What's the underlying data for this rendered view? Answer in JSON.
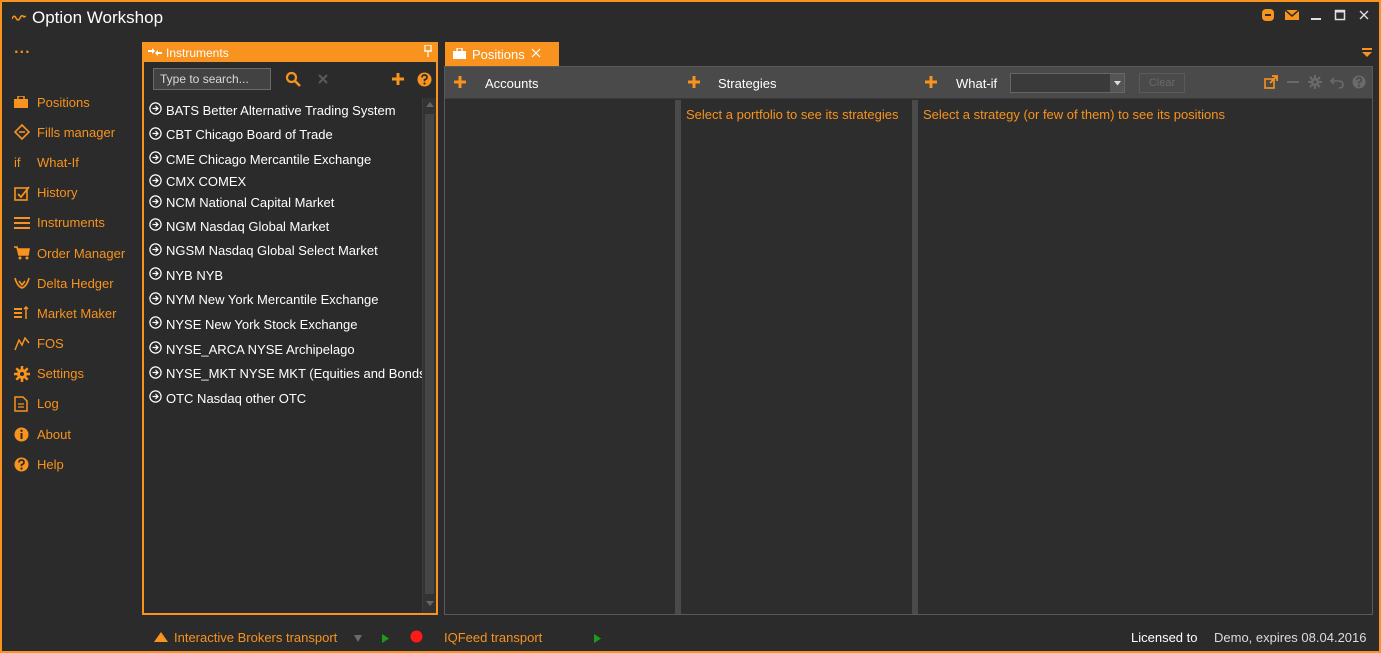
{
  "app": {
    "title": "Option Workshop",
    "accent": "#f7931e"
  },
  "nav": {
    "more": "...",
    "items": [
      {
        "label": "Positions",
        "icon": "briefcase-icon"
      },
      {
        "label": "Fills manager",
        "icon": "fills-icon"
      },
      {
        "label": "What-If",
        "icon": "whatif-icon",
        "glyph": "if"
      },
      {
        "label": "History",
        "icon": "history-icon"
      },
      {
        "label": "Instruments",
        "icon": "list-icon"
      },
      {
        "label": "Order Manager",
        "icon": "cart-icon"
      },
      {
        "label": "Delta Hedger",
        "icon": "delta-hedger-icon"
      },
      {
        "label": "Market Maker",
        "icon": "market-maker-icon"
      },
      {
        "label": "FOS",
        "icon": "fos-icon"
      },
      {
        "label": "Settings",
        "icon": "gear-icon"
      },
      {
        "label": "Log",
        "icon": "log-icon"
      },
      {
        "label": "About",
        "icon": "info-icon"
      },
      {
        "label": "Help",
        "icon": "help-icon"
      }
    ]
  },
  "instruments": {
    "title": "Instruments",
    "search_placeholder": "Type to search...",
    "items": [
      "BATS Better Alternative Trading System",
      "CBT Chicago Board of Trade",
      "CME Chicago Mercantile Exchange",
      "CMX COMEX",
      "NCM National Capital Market",
      "NGM Nasdaq Global Market",
      "NGSM Nasdaq Global Select Market",
      "NYB NYB",
      "NYM New York Mercantile Exchange",
      "NYSE New York Stock Exchange",
      "NYSE_ARCA NYSE Archipelago",
      "NYSE_MKT NYSE MKT (Equities and Bonds)",
      "OTC Nasdaq other OTC"
    ]
  },
  "positions": {
    "tab_label": "Positions",
    "accounts_label": "Accounts",
    "strategies_label": "Strategies",
    "whatif_label": "What-if",
    "clear_label": "Clear",
    "strategies_hint": "Select a portfolio to see its strategies",
    "positions_hint": "Select a strategy (or few of them) to see its positions"
  },
  "status": {
    "ib_transport": "Interactive Brokers transport",
    "iq_transport": "IQFeed transport",
    "licensed_label": "Licensed to",
    "license_info": "Demo, expires 08.04.2016"
  }
}
